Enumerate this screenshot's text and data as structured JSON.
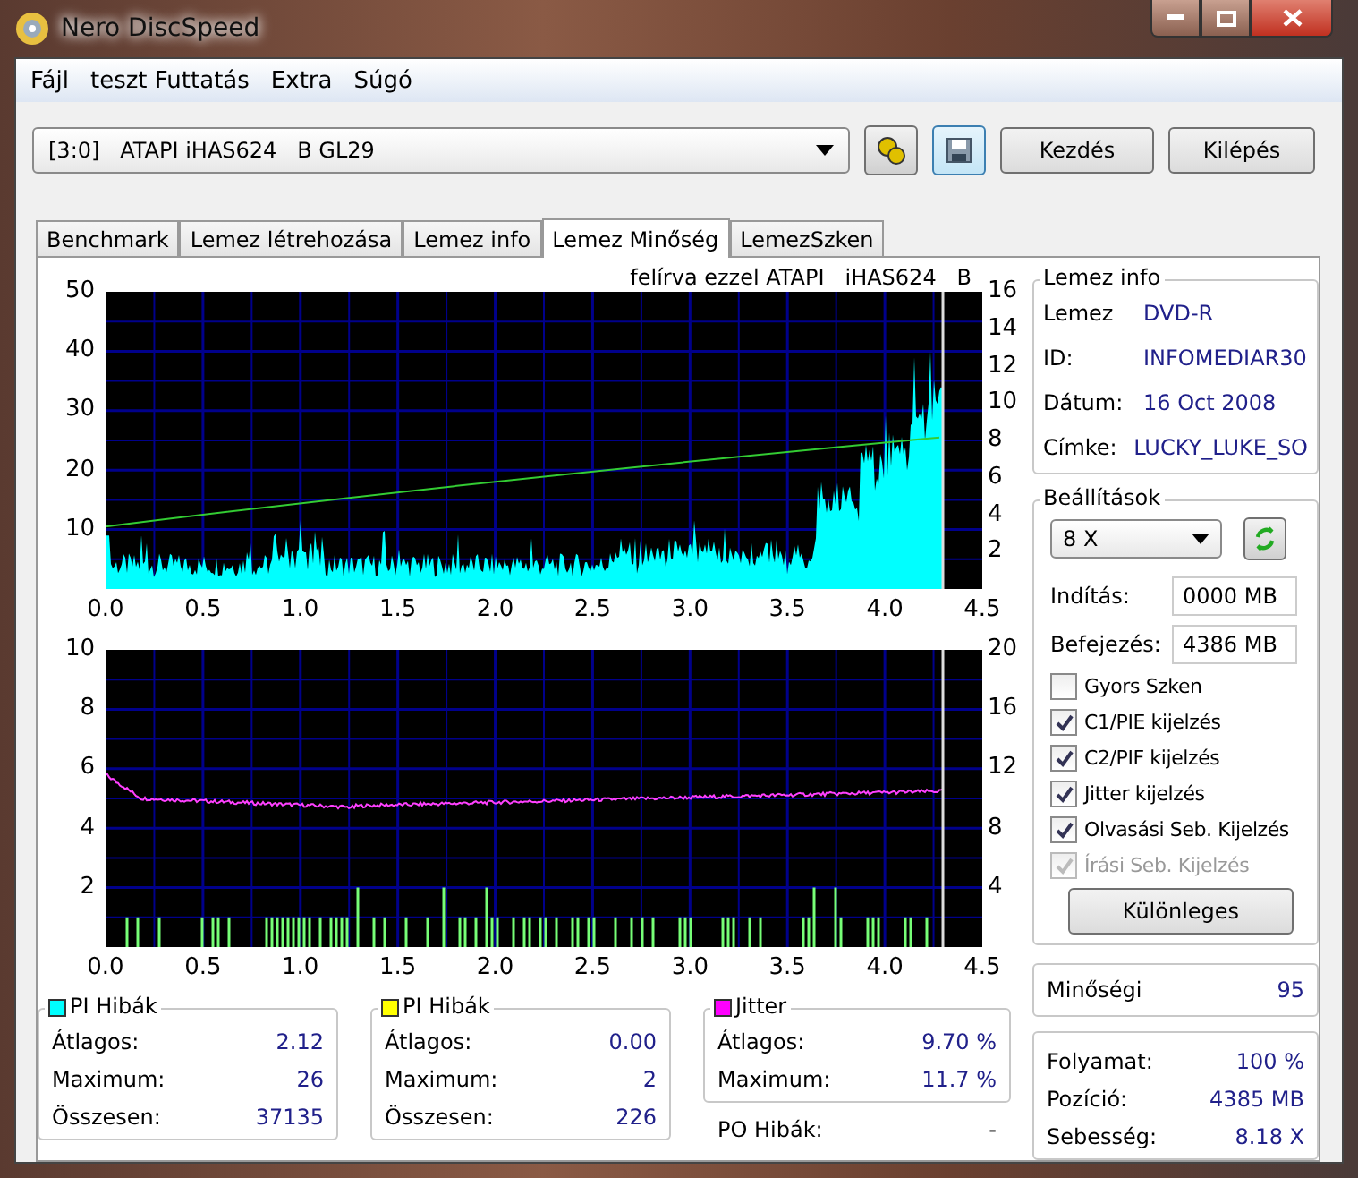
{
  "window": {
    "title": "Nero DiscSpeed"
  },
  "menu": [
    "Fájl",
    "teszt Futtatás",
    "Extra",
    "Súgó"
  ],
  "drive": {
    "value": "[3:0]   ATAPI iHAS624   B GL29"
  },
  "buttons": [
    "Kezdés",
    "Kilépés"
  ],
  "tabs": [
    {
      "label": "Benchmark",
      "selected": false
    },
    {
      "label": "Lemez létrehozása",
      "selected": false
    },
    {
      "label": "Lemez info",
      "selected": false
    },
    {
      "label": "Lemez Minőség",
      "selected": true
    },
    {
      "label": "LemezSzken",
      "selected": false
    }
  ],
  "chart_top": {
    "caption": "felírva ezzel ATAPI   iHAS624   B",
    "left_ticks": [
      "50",
      "40",
      "30",
      "20",
      "10"
    ],
    "right_ticks": [
      "16",
      "14",
      "12",
      "10",
      "8",
      "6",
      "4",
      "2"
    ],
    "x_ticks": [
      "0.0",
      "0.5",
      "1.0",
      "1.5",
      "2.0",
      "2.5",
      "3.0",
      "3.5",
      "4.0",
      "4.5"
    ]
  },
  "chart_bottom": {
    "left_ticks": [
      "10",
      "8",
      "6",
      "4",
      "2"
    ],
    "right_ticks": [
      "20",
      "16",
      "12",
      "8",
      "4"
    ],
    "x_ticks": [
      "0.0",
      "0.5",
      "1.0",
      "1.5",
      "2.0",
      "2.5",
      "3.0",
      "3.5",
      "4.0",
      "4.5"
    ]
  },
  "disc_info": {
    "title": "Lemez info",
    "rows": [
      {
        "label": "Lemez",
        "value": "DVD-R"
      },
      {
        "label": "ID:",
        "value": "INFOMEDIAR30"
      },
      {
        "label": "Dátum:",
        "value": "16 Oct 2008"
      },
      {
        "label": "Címke:",
        "value": "LUCKY_LUKE_SO"
      }
    ]
  },
  "settings": {
    "title": "Beállítások",
    "speed": "8 X",
    "start": {
      "label": "Indítás:",
      "value": "0000 MB"
    },
    "end": {
      "label": "Befejezés:",
      "value": "4386 MB"
    },
    "checks": [
      {
        "label": "Gyors Szken",
        "checked": false,
        "disabled": false
      },
      {
        "label": "C1/PIE kijelzés",
        "checked": true,
        "disabled": false
      },
      {
        "label": "C2/PIF kijelzés",
        "checked": true,
        "disabled": false
      },
      {
        "label": "Jitter kijelzés",
        "checked": true,
        "disabled": false
      },
      {
        "label": "Olvasási Seb. Kijelzés",
        "checked": true,
        "disabled": false
      },
      {
        "label": "Írási Seb. Kijelzés",
        "checked": true,
        "disabled": true
      }
    ],
    "button": "Különleges"
  },
  "quality": {
    "label": "Minőségi",
    "value": "95"
  },
  "stats": [
    {
      "title": "PI Hibák",
      "color": "#00ffff",
      "rows": [
        {
          "label": "Átlagos:",
          "value": "2.12"
        },
        {
          "label": "Maximum:",
          "value": "26"
        },
        {
          "label": "Összesen:",
          "value": "37135"
        }
      ]
    },
    {
      "title": "PI Hibák",
      "color": "#ffff00",
      "rows": [
        {
          "label": "Átlagos:",
          "value": "0.00"
        },
        {
          "label": "Maximum:",
          "value": "2"
        },
        {
          "label": "Összesen:",
          "value": "226"
        }
      ]
    },
    {
      "title": "Jitter",
      "color": "#ff00ff",
      "rows": [
        {
          "label": "Átlagos:",
          "value": "9.70 %"
        },
        {
          "label": "Maximum:",
          "value": "11.7 %"
        }
      ]
    }
  ],
  "po_errors": {
    "label": "PO Hibák:",
    "value": "-"
  },
  "progress": [
    {
      "label": "Folyamat:",
      "value": "100 %"
    },
    {
      "label": "Pozíció:",
      "value": "4385 MB"
    },
    {
      "label": "Sebesség:",
      "value": "8.18 X"
    }
  ]
}
